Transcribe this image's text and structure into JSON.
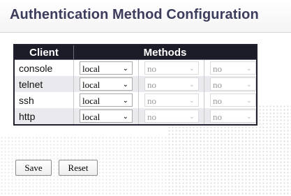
{
  "page": {
    "title": "Authentication Method Configuration"
  },
  "table": {
    "headers": {
      "client": "Client",
      "methods": "Methods"
    },
    "rows": [
      {
        "client": "console",
        "m1": "local",
        "m2": "no",
        "m3": "no"
      },
      {
        "client": "telnet",
        "m1": "local",
        "m2": "no",
        "m3": "no"
      },
      {
        "client": "ssh",
        "m1": "local",
        "m2": "no",
        "m3": "no"
      },
      {
        "client": "http",
        "m1": "local",
        "m2": "no",
        "m3": "no"
      }
    ]
  },
  "buttons": {
    "save": "Save",
    "reset": "Reset"
  },
  "icons": {
    "dropdown": "chevron-down-icon"
  },
  "colors": {
    "header_bg": "#1c1c28",
    "title": "#3c3c5c",
    "row_alt": "#e9e9ee"
  }
}
